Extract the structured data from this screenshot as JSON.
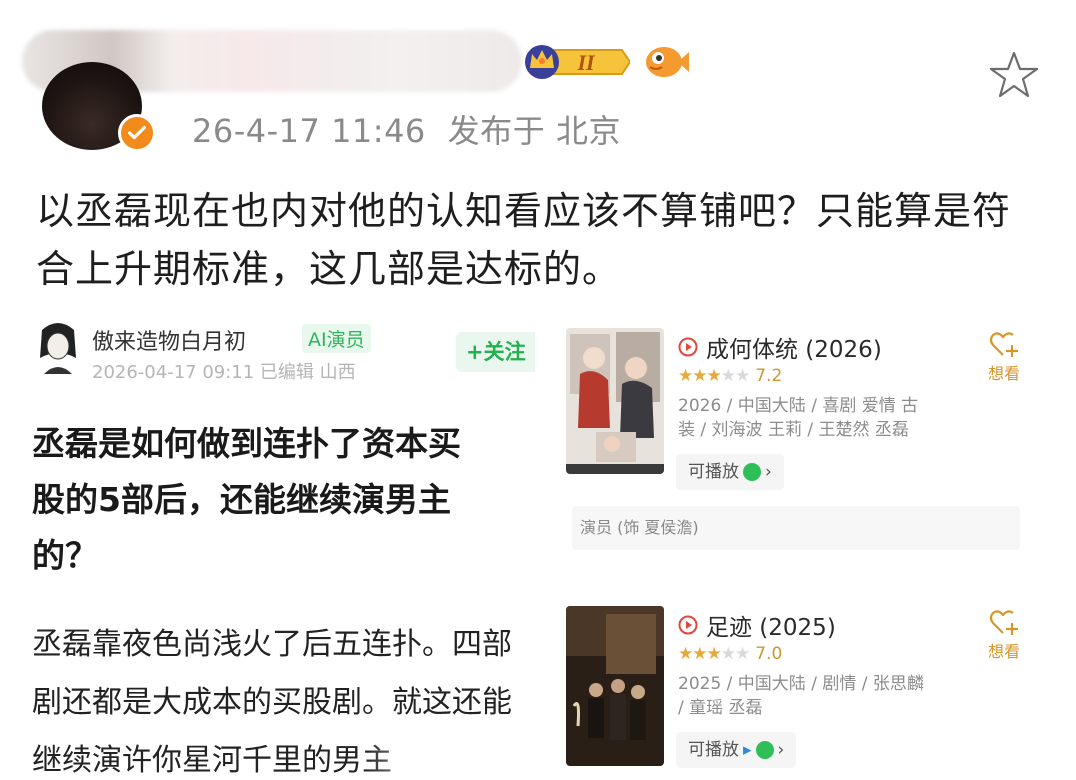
{
  "post": {
    "meta_time": "26-4-17 11:46",
    "meta_location": "发布于 北京",
    "body": "以丞磊现在也内对他的认知看应该不算铺吧？只能算是符合上升期标准，这几部是达标的。",
    "vip_level": "II"
  },
  "embedded_article": {
    "author": "傲来造物白月初",
    "author_tag": "AI演员",
    "follow_label": "+关注",
    "meta": "2026-04-17 09:11 已编辑 山西",
    "title": "丞磊是如何做到连扑了资本买\n股的5部后，还能继续演男主\n的？",
    "text": "丞磊靠夜色尚浅火了后五连扑。四部\n剧还都是大成本的买股剧。就这还能\n继续演许你星河千里的男主"
  },
  "cards": [
    {
      "title": "成何体统 (2026)",
      "rating": "7.2",
      "info": "2026 / 中国大陆 / 喜剧 爱情 古装 / 刘海波 王莉 / 王楚然 丞磊",
      "playable": "可播放",
      "want": "想看",
      "actor_strip": "演员 (饰 夏侯澹)"
    },
    {
      "title": "足迹 (2025)",
      "rating": "7.0",
      "info": "2025 / 中国大陆 / 剧情 / 张思麟 / 童瑶 丞磊",
      "playable": "可播放",
      "want": "想看"
    }
  ],
  "colors": {
    "verify": "#f28b1c",
    "ai_tag": "#2fb45a",
    "follow": "#23b04f",
    "want": "#d6962a"
  },
  "icons": [
    "verified-icon",
    "vip-crown-icon",
    "fish-icon",
    "star-outline-icon",
    "play-circle-icon",
    "heart-plus-icon"
  ]
}
